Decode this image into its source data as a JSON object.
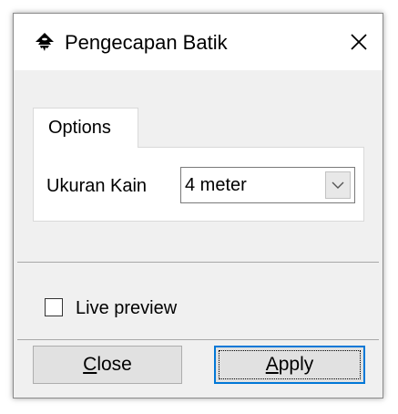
{
  "window": {
    "title": "Pengecapan Batik",
    "icon": "inkscape-logo-icon",
    "close_glyph": "close-icon"
  },
  "tabs": [
    {
      "label": "Options",
      "active": true
    }
  ],
  "form": {
    "size_label": "Ukuran Kain",
    "size_value": "4 meter",
    "size_dropdown_icon": "chevron-down-icon"
  },
  "preview": {
    "label": "Live preview",
    "checked": false
  },
  "buttons": {
    "close": {
      "mnemonic": "C",
      "rest": "lose"
    },
    "apply": {
      "mnemonic": "A",
      "rest": "pply"
    }
  },
  "colors": {
    "accent": "#0078d7",
    "dialog_bg": "#f0f0f0",
    "titlebar_bg": "#ffffff"
  }
}
